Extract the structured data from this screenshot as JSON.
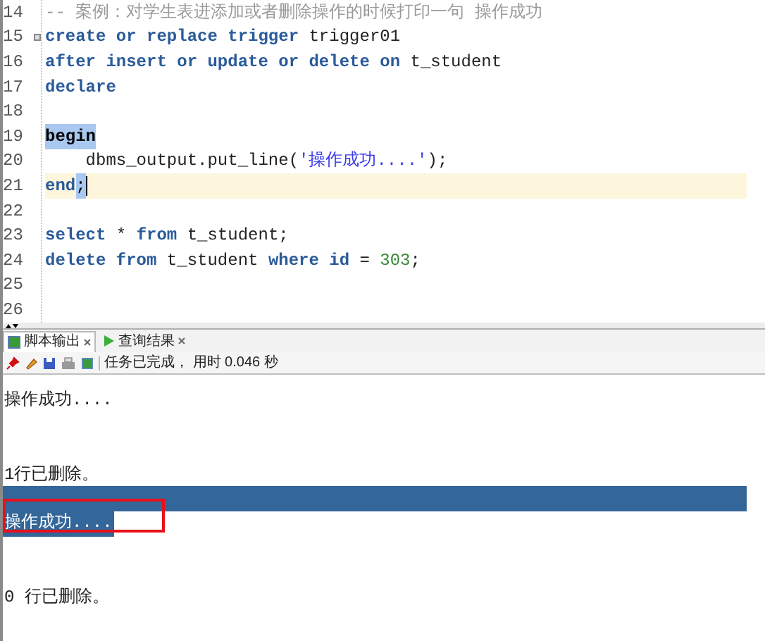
{
  "editor": {
    "lines": [
      {
        "number": "14",
        "current": false,
        "fold": false,
        "tokens": [
          {
            "kind": "comment",
            "text": "-- 案例：对学生表进添加或者删除操作的时候打印一句 操作成功"
          }
        ]
      },
      {
        "number": "15",
        "current": false,
        "fold": true,
        "tokens": [
          {
            "kind": "kw",
            "text": "create or replace trigger"
          },
          {
            "kind": "id",
            "text": " trigger01"
          }
        ]
      },
      {
        "number": "16",
        "current": false,
        "fold": false,
        "tokens": [
          {
            "kind": "kw",
            "text": "after insert or update or delete on"
          },
          {
            "kind": "id",
            "text": " t_student"
          }
        ]
      },
      {
        "number": "17",
        "current": false,
        "fold": false,
        "tokens": [
          {
            "kind": "kw",
            "text": "declare"
          }
        ]
      },
      {
        "number": "18",
        "current": false,
        "fold": false
      },
      {
        "number": "19",
        "current": false,
        "fold": false,
        "tokens": [
          {
            "kind": "match",
            "text": "begin"
          }
        ]
      },
      {
        "number": "20",
        "current": false,
        "fold": false,
        "tokens": [
          {
            "kind": "id",
            "text": "    dbms_output.put_line("
          },
          {
            "kind": "str",
            "text": "'操作成功....'"
          },
          {
            "kind": "id",
            "text": ");"
          }
        ]
      },
      {
        "number": "21",
        "current": true,
        "fold": false,
        "tokens": [
          {
            "kind": "kw",
            "text": "end"
          },
          {
            "kind": "sel",
            "text": ";"
          }
        ]
      },
      {
        "number": "22",
        "current": false,
        "fold": false
      },
      {
        "number": "23",
        "current": false,
        "fold": false,
        "tokens": [
          {
            "kind": "kw",
            "text": "select"
          },
          {
            "kind": "id",
            "text": " * "
          },
          {
            "kind": "kw",
            "text": "from"
          },
          {
            "kind": "id",
            "text": " t_student;"
          }
        ]
      },
      {
        "number": "24",
        "current": false,
        "fold": false,
        "tokens": [
          {
            "kind": "kw",
            "text": "delete from"
          },
          {
            "kind": "id",
            "text": " t_student "
          },
          {
            "kind": "kw",
            "text": "where id"
          },
          {
            "kind": "id",
            "text": " = "
          },
          {
            "kind": "num",
            "text": "303"
          },
          {
            "kind": "id",
            "text": ";"
          }
        ]
      },
      {
        "number": "25",
        "current": false,
        "fold": false
      },
      {
        "number": "26",
        "current": false,
        "fold": false
      }
    ]
  },
  "panel": {
    "tabs": [
      {
        "label": "脚本输出",
        "selected": true
      },
      {
        "label": "查询结果",
        "selected": false
      }
    ],
    "status": "任务已完成， 用时 0.046 秒",
    "output": [
      {
        "text": "操作成功....",
        "selected": false,
        "boxed": false
      },
      {
        "text": "1行已删除。",
        "selected": false,
        "boxed": false
      },
      {
        "text": "操作成功....",
        "selected": true,
        "boxed": true
      },
      {
        "text": "0 行已删除。",
        "selected": false,
        "boxed": false
      }
    ]
  }
}
